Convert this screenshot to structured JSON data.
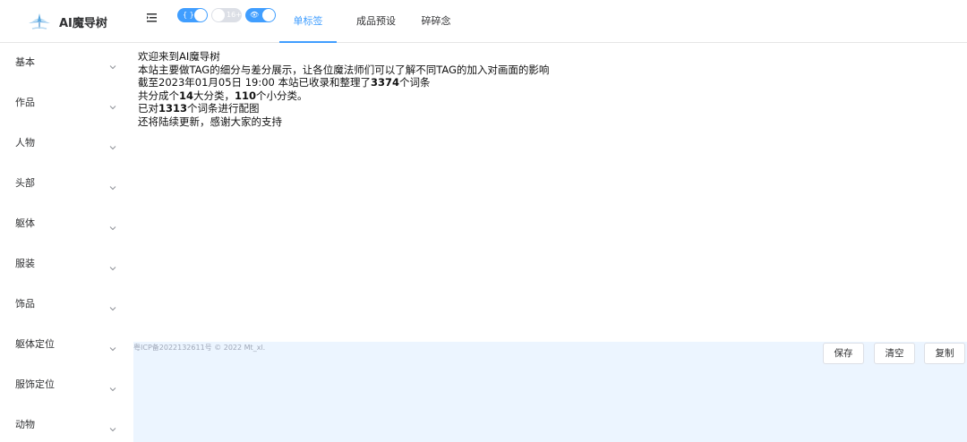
{
  "app": {
    "title": "AI魔导树"
  },
  "header": {
    "toggles": [
      {
        "label": "{ }",
        "on": true,
        "color": "#409eff"
      },
      {
        "label": "16+",
        "on": false,
        "color": "#dcdfe6"
      },
      {
        "label": "👁",
        "on": true,
        "color": "#409eff"
      }
    ],
    "tabs": [
      {
        "label": "单标签",
        "active": true
      },
      {
        "label": "成品预设",
        "active": false
      },
      {
        "label": "碎碎念",
        "active": false
      }
    ]
  },
  "sidebar": {
    "items": [
      {
        "label": "基本"
      },
      {
        "label": "作品"
      },
      {
        "label": "人物"
      },
      {
        "label": "头部"
      },
      {
        "label": "躯体"
      },
      {
        "label": "服装"
      },
      {
        "label": "饰品"
      },
      {
        "label": "躯体定位"
      },
      {
        "label": "服饰定位"
      },
      {
        "label": "动物"
      }
    ]
  },
  "intro": {
    "line1": "欢迎来到AI魔导树",
    "line2": "本站主要做TAG的细分与差分展示，让各位魔法师们可以了解不同TAG的加入对画面的影响",
    "line3_pre": "截至2023年01月05日 19:00 本站已收录和整理了",
    "line3_num": "3374",
    "line3_post": "个词条",
    "line4_a": "共分成个",
    "line4_num1": "14",
    "line4_b": "大分类，",
    "line4_num2": "110",
    "line4_c": "个小分类。",
    "line5_a": "已对",
    "line5_num": "1313",
    "line5_b": "个词条进行配图",
    "line6": "还将陆续更新，感谢大家的支持"
  },
  "footer": {
    "icp": "粤ICP备2022132611号 © 2022 Mt_xl.",
    "buttons": {
      "save": "保存",
      "clear": "清空",
      "copy": "复制"
    }
  },
  "colors": {
    "accent": "#409eff",
    "editor_bg": "#ecf5ff"
  }
}
